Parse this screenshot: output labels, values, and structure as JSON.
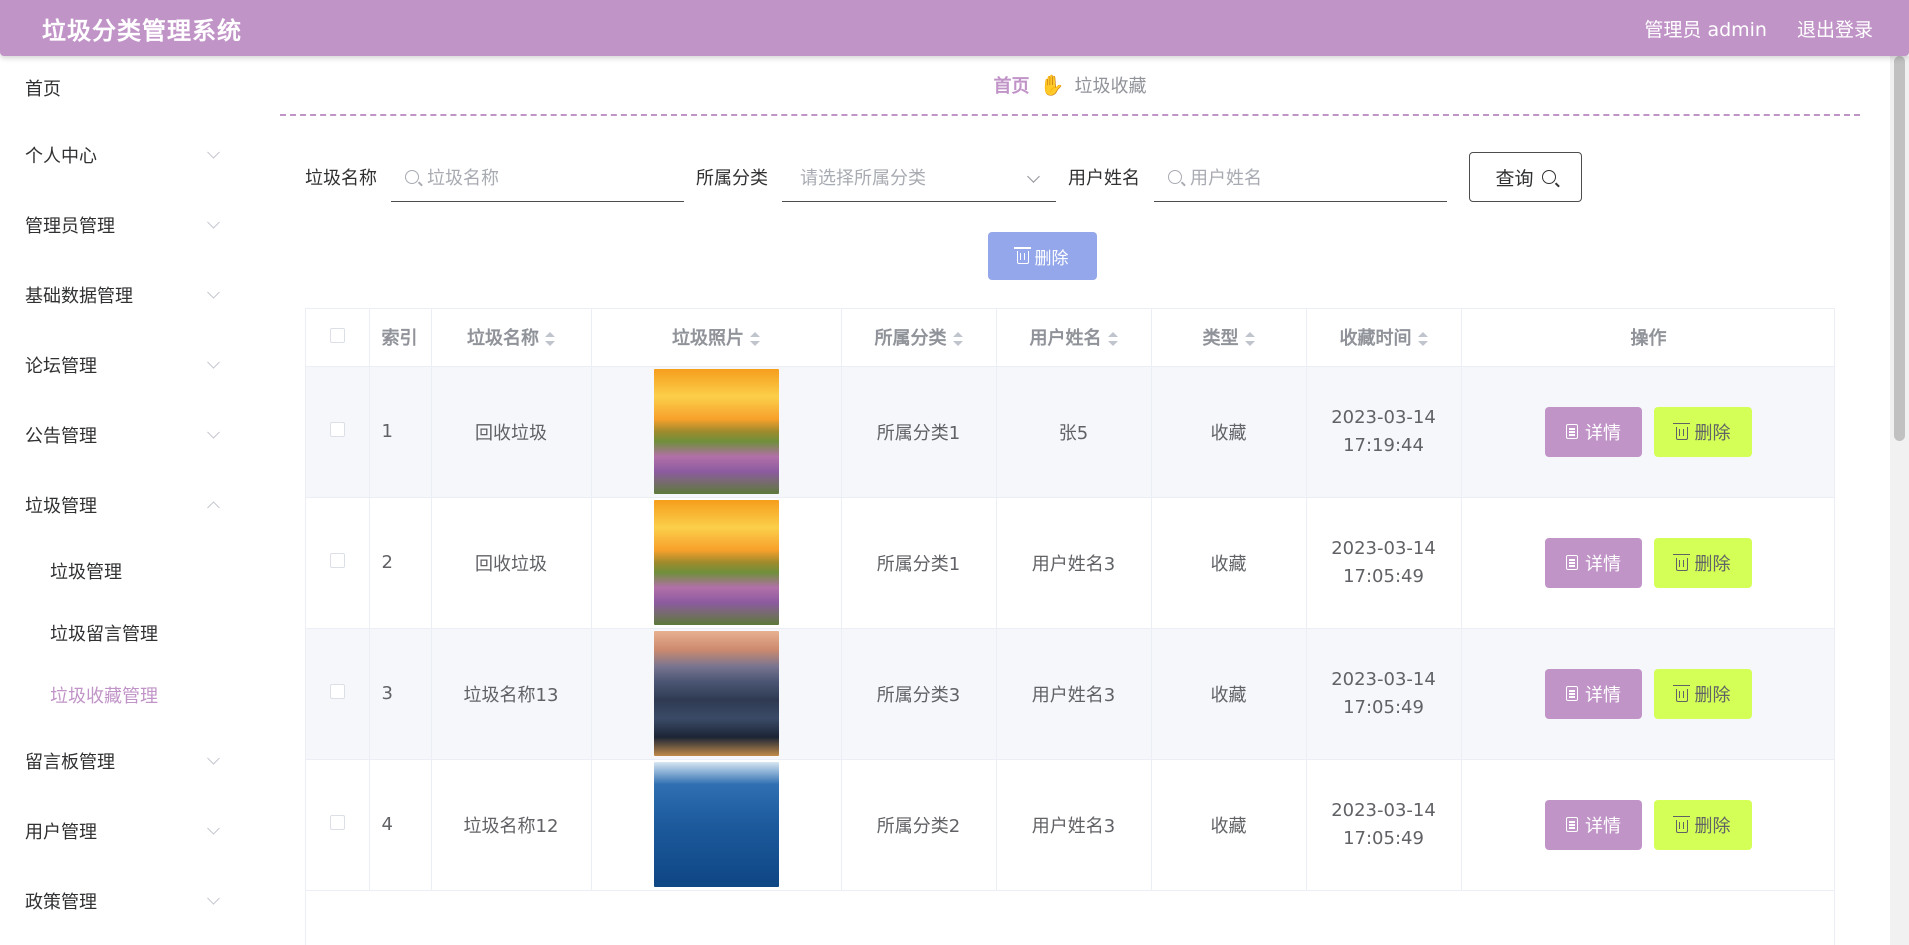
{
  "header": {
    "title": "垃圾分类管理系统",
    "user": "管理员 admin",
    "logout": "退出登录"
  },
  "sidebar": {
    "items": [
      {
        "label": "首页"
      },
      {
        "label": "个人中心"
      },
      {
        "label": "管理员管理"
      },
      {
        "label": "基础数据管理"
      },
      {
        "label": "论坛管理"
      },
      {
        "label": "公告管理"
      },
      {
        "label": "垃圾管理"
      },
      {
        "label": "留言板管理"
      },
      {
        "label": "用户管理"
      },
      {
        "label": "政策管理"
      }
    ],
    "submenu": [
      {
        "label": "垃圾管理"
      },
      {
        "label": "垃圾留言管理"
      },
      {
        "label": "垃圾收藏管理"
      }
    ]
  },
  "breadcrumb": {
    "home": "首页",
    "current": "垃圾收藏"
  },
  "search": {
    "name_label": "垃圾名称",
    "name_placeholder": "垃圾名称",
    "category_label": "所属分类",
    "category_placeholder": "请选择所属分类",
    "user_label": "用户姓名",
    "user_placeholder": "用户姓名",
    "query_label": "查询"
  },
  "bulk_delete_label": "删除",
  "table": {
    "headers": [
      "索引",
      "垃圾名称",
      "垃圾照片",
      "所属分类",
      "用户姓名",
      "类型",
      "收藏时间",
      "操作"
    ],
    "rows": [
      {
        "index": "1",
        "name": "回收垃圾",
        "image": "flowers",
        "category": "所属分类1",
        "user": "张5",
        "type": "收藏",
        "time": "2023-03-14 17:19:44"
      },
      {
        "index": "2",
        "name": "回收垃圾",
        "image": "flowers",
        "category": "所属分类1",
        "user": "用户姓名3",
        "type": "收藏",
        "time": "2023-03-14 17:05:49"
      },
      {
        "index": "3",
        "name": "垃圾名称13",
        "image": "city",
        "category": "所属分类3",
        "user": "用户姓名3",
        "type": "收藏",
        "time": "2023-03-14 17:05:49"
      },
      {
        "index": "4",
        "name": "垃圾名称12",
        "image": "sea",
        "category": "所属分类2",
        "user": "用户姓名3",
        "type": "收藏",
        "time": "2023-03-14 17:05:49"
      }
    ],
    "detail_label": "详情",
    "delete_label": "删除"
  },
  "colors": {
    "primary": "#c194c8",
    "delete_button": "#d4ff57",
    "bulk_delete": "#94a7ea"
  }
}
